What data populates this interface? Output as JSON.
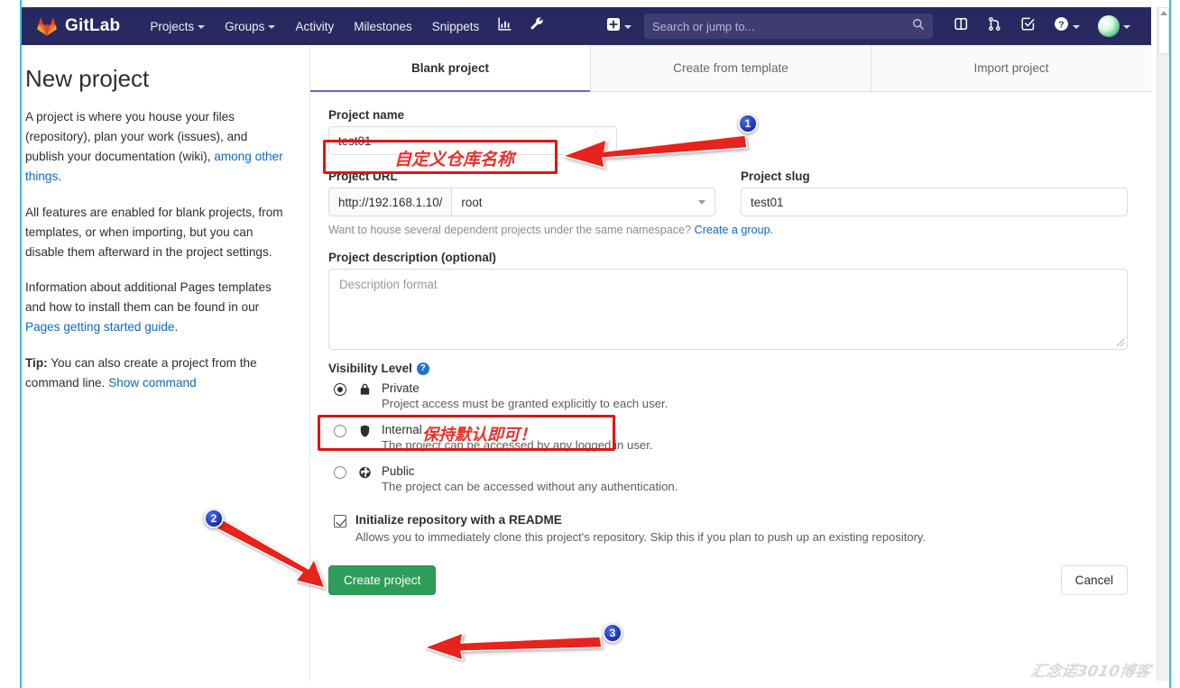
{
  "navbar": {
    "brand": "GitLab",
    "links": [
      {
        "label": "Projects",
        "caret": true
      },
      {
        "label": "Groups",
        "caret": true
      },
      {
        "label": "Activity",
        "caret": false
      },
      {
        "label": "Milestones",
        "caret": false
      },
      {
        "label": "Snippets",
        "caret": false
      }
    ],
    "icons": [
      "analytics-chart-icon",
      "wrench-icon"
    ],
    "new_label": "plus-icon",
    "search_placeholder": "Search or jump to...",
    "search_icon": "search-icon",
    "right_icons": [
      "issues-board-icon",
      "merge-request-icon",
      "todos-check-icon",
      "help-question-icon",
      "user-avatar"
    ]
  },
  "aside": {
    "title": "New project",
    "p1_a": "A project is where you house your files (repository), plan your work (issues), and publish your documentation (wiki), ",
    "p1_link": "among other things",
    "p1_b": ".",
    "p2": "All features are enabled for blank projects, from templates, or when importing, but you can disable them afterward in the project settings.",
    "p3_a": "Information about additional Pages templates and how to install them can be found in our ",
    "p3_link": "Pages getting started guide",
    "p3_b": ".",
    "p4_tip": "Tip:",
    "p4_a": " You can also create a project from the command line. ",
    "p4_link": "Show command"
  },
  "tabs": [
    {
      "label": "Blank project",
      "active": true
    },
    {
      "label": "Create from template",
      "active": false
    },
    {
      "label": "Import project",
      "active": false
    }
  ],
  "form": {
    "project_name_label": "Project name",
    "project_name_value": "test01",
    "project_url_label": "Project URL",
    "project_url_prefix": "http://192.168.1.10/",
    "project_url_namespace": "root",
    "project_slug_label": "Project slug",
    "project_slug_value": "test01",
    "namespace_helper_text": "Want to house several dependent projects under the same namespace? ",
    "namespace_helper_link": "Create a group.",
    "description_label": "Project description (optional)",
    "description_placeholder": "Description format",
    "visibility_label": "Visibility Level",
    "visibility_help_icon": "?",
    "visibility_options": [
      {
        "name": "Private",
        "icon": "lock-icon",
        "desc": "Project access must be granted explicitly to each user.",
        "selected": true
      },
      {
        "name": "Internal",
        "icon": "shield-icon",
        "desc": "The project can be accessed by any logged in user.",
        "selected": false
      },
      {
        "name": "Public",
        "icon": "globe-icon",
        "desc": "The project can be accessed without any authentication.",
        "selected": false
      }
    ],
    "readme_label": "Initialize repository with a README",
    "readme_desc": "Allows you to immediately clone this project's repository. Skip this if you plan to push up an existing repository.",
    "readme_checked": true,
    "create_button": "Create project",
    "cancel_button": "Cancel"
  },
  "annotations": {
    "badge1": "1",
    "badge2": "2",
    "badge3": "3",
    "note_name": "自定义仓库名称",
    "note_visibility": "保持默认即可！",
    "accent_red": "#e11414",
    "badge_blue": "#1a2fb5"
  },
  "watermark": "汇念诺3010博客"
}
